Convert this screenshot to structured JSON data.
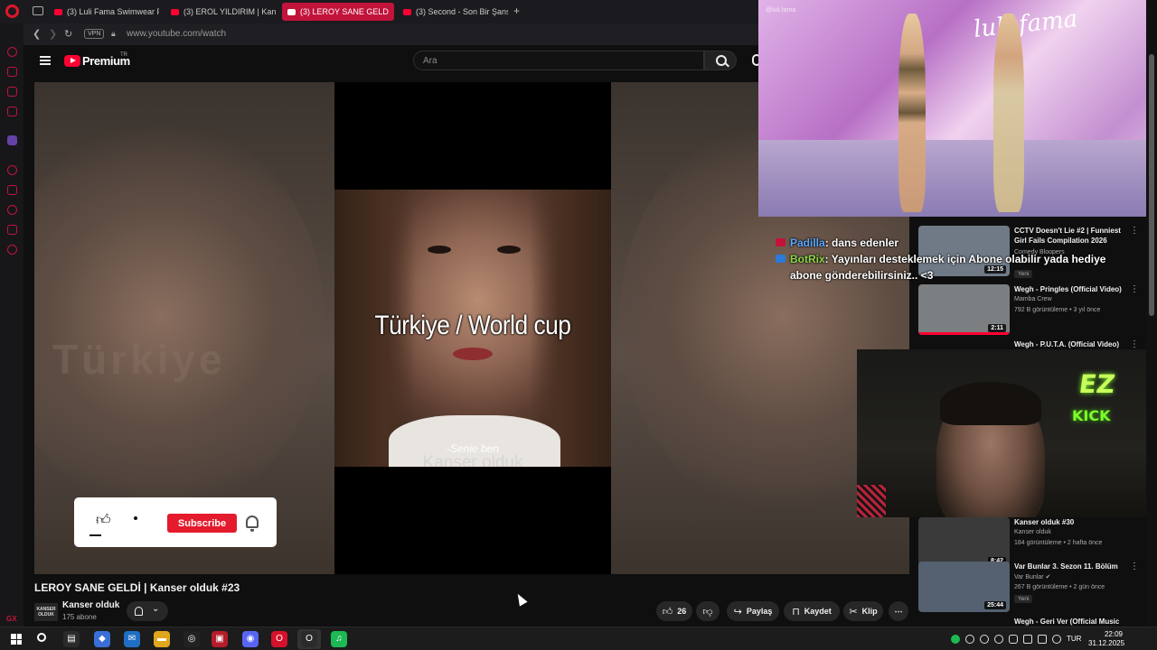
{
  "browser": {
    "tabs": [
      {
        "label": "(3) Luli Fama Swimwear Fa",
        "active": false
      },
      {
        "label": "(3) EROL YILDIRIM | Kanse",
        "active": false
      },
      {
        "label": "(3) LEROY SANE GELD",
        "active": true
      },
      {
        "label": "(3) Second - Son Bir Şans",
        "active": false
      }
    ],
    "new_tab": "+",
    "vpn": "VPN",
    "url": "www.youtube.com/watch",
    "accent_color": "#c2133b"
  },
  "youtube": {
    "logo_text": "Premium",
    "logo_region": "TR",
    "search": {
      "placeholder": "Ara"
    },
    "brand_color": "#ff0033"
  },
  "video": {
    "title_overlay": "Türkiye / World cup",
    "subtitle": "-Senie ben",
    "watermark": "Kanser olduk",
    "blur_text": "Türkiye",
    "subscribe_label": "Subscribe",
    "title": "LEROY SANE GELDİ | Kanser olduk #23",
    "channel": {
      "avatar_text": "KANSER OLDUK",
      "name": "Kanser olduk",
      "subs": "175 abone"
    },
    "actions": {
      "likes": "26",
      "share": "Paylaş",
      "save": "Kaydet",
      "clip": "Klip",
      "more": "⋯"
    }
  },
  "overlay": {
    "brand": "luli fama",
    "watermark": "@luli.fama"
  },
  "recommendations": [
    {
      "title": "CCTV Doesn't Lie #2 | Funniest Girl Fails Compilation 2026",
      "channel": "Comedy Bloopers",
      "meta": "",
      "badge": "Yeni",
      "duration": "12:15",
      "thumb_color": "#6f7a86"
    },
    {
      "title": "Wegh - Pringles (Official Video)",
      "channel": "Mamba Crew",
      "meta": "792 B görüntüleme • 3 yıl önce",
      "badge": "",
      "duration": "2:11",
      "thumb_color": "#7c7f82"
    },
    {
      "title": "Wegh - P.U.T.A. (Official Video)",
      "channel": "",
      "meta": "",
      "badge": "",
      "duration": "",
      "thumb_color": "#333"
    },
    {
      "title": "Kanser olduk #30",
      "channel": "Kanser olduk",
      "meta": "184 görüntüleme • 2 hafta önce",
      "badge": "",
      "duration": "8:42",
      "thumb_color": "#3a3a3a"
    },
    {
      "title": "Var Bunlar 3. Sezon 11. Bölüm",
      "channel": "Var Bunlar ✔",
      "meta": "267 B görüntüleme • 2 gün önce",
      "badge": "Yeni",
      "duration": "25:44",
      "thumb_color": "#556070"
    },
    {
      "title": "Wegh - Geri Ver (Official Music",
      "channel": "",
      "meta": "",
      "badge": "",
      "duration": "",
      "thumb_color": "#333"
    }
  ],
  "chat": [
    {
      "user": "Padilla",
      "message": ": dans edenler"
    },
    {
      "user": "BotRix",
      "message": ": Yayınları desteklemek için Abone olabilir yada hediye abone gönderebilirsiniz.. <3"
    }
  ],
  "webcam": {
    "logo_top": "EZ",
    "logo_bottom": "KICK"
  },
  "taskbar": {
    "language": "TUR",
    "time": "22:09",
    "date": "31.12.2025",
    "apps": [
      {
        "name": "task-view",
        "glyph": "▤",
        "color": "#2b2b2b"
      },
      {
        "name": "copilot",
        "glyph": "◆",
        "color": "#3a6fd8"
      },
      {
        "name": "outlook",
        "glyph": "✉",
        "color": "#1f6fc5"
      },
      {
        "name": "file-explorer",
        "glyph": "▬",
        "color": "#e0a61c"
      },
      {
        "name": "edge",
        "glyph": "◎",
        "color": "#222"
      },
      {
        "name": "voice-app",
        "glyph": "▣",
        "color": "#b51d2a"
      },
      {
        "name": "discord",
        "glyph": "◉",
        "color": "#5865f2"
      },
      {
        "name": "opera",
        "glyph": "O",
        "color": "#d5122b"
      },
      {
        "name": "opera-gx",
        "glyph": "O",
        "color": "#2b2b2b"
      },
      {
        "name": "spotify",
        "glyph": "♫",
        "color": "#1db954"
      }
    ]
  }
}
